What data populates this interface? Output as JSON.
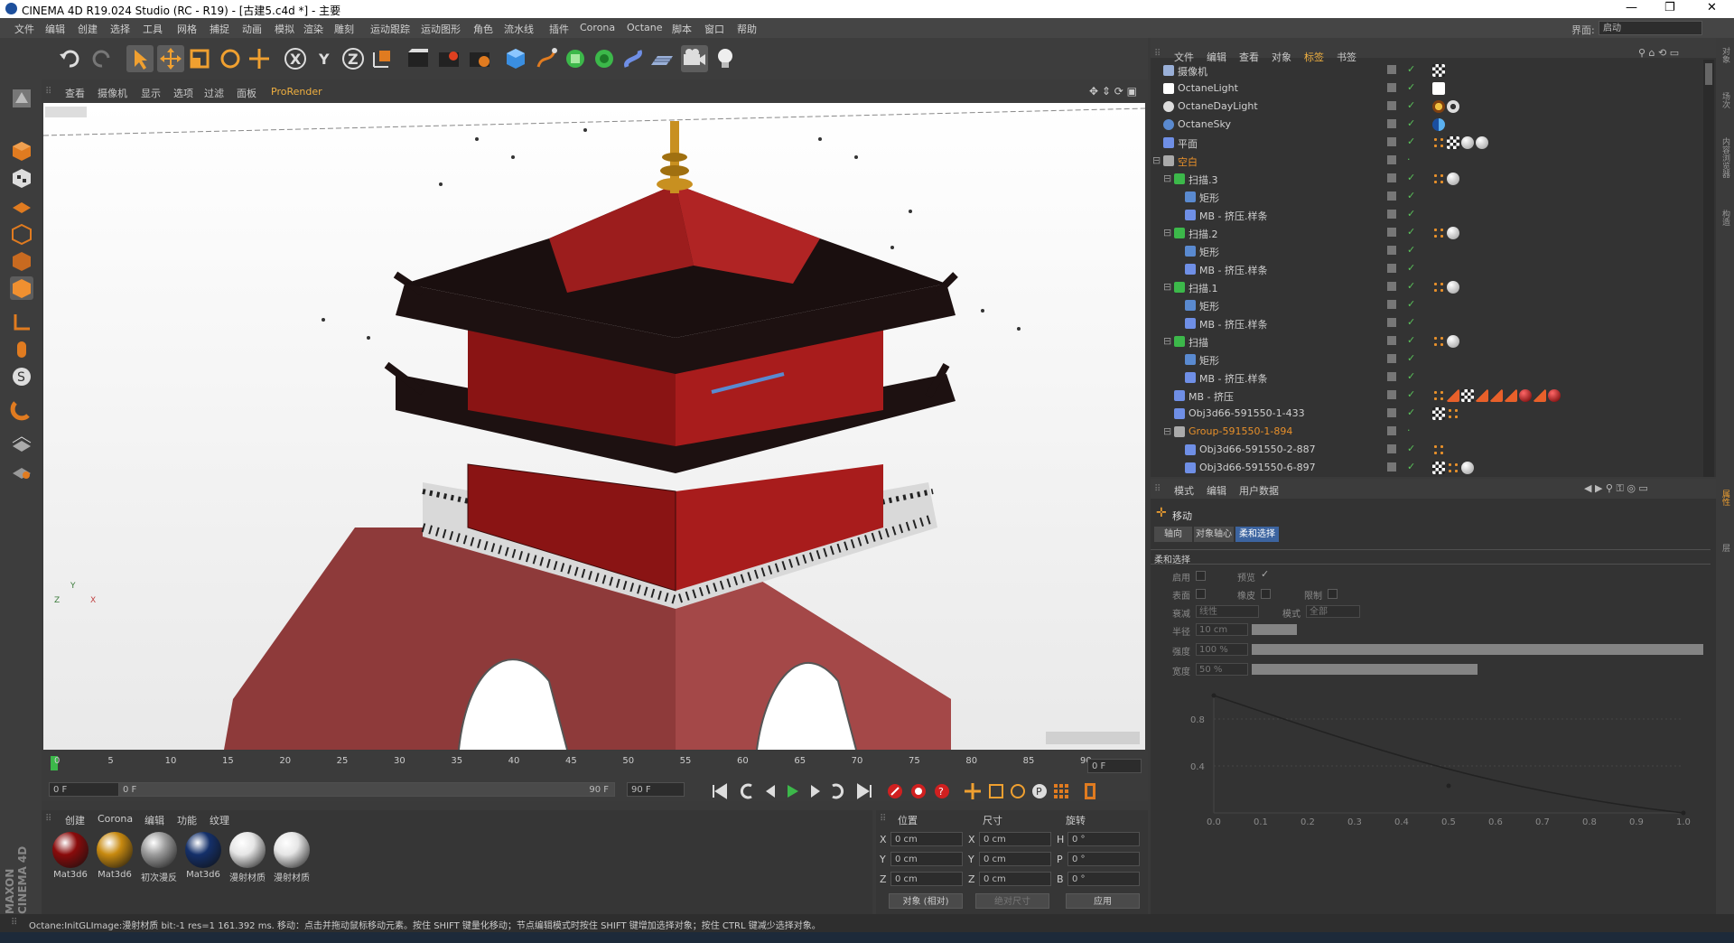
{
  "window": {
    "title": "CINEMA 4D R19.024 Studio (RC - R19) - [古建5.c4d *] - 主要",
    "controls": [
      "—",
      "❐",
      "✕"
    ]
  },
  "menubar": {
    "items": [
      "文件",
      "编辑",
      "创建",
      "选择",
      "工具",
      "网格",
      "捕捉",
      "动画",
      "模拟",
      "渲染",
      "雕刻",
      "运动跟踪",
      "运动图形",
      "角色",
      "流水线",
      "插件",
      "Corona",
      "Octane",
      "脚本",
      "窗口",
      "帮助"
    ],
    "layout_label": "界面:",
    "layout_value": "启动"
  },
  "viewport": {
    "menu": [
      "查看",
      "摄像机",
      "显示",
      "选项",
      "过滤",
      "面板",
      "ProRender"
    ],
    "axis_labels": {
      "y": "Y",
      "z": "Z",
      "x": "X"
    }
  },
  "timeline": {
    "ticks": [
      "0",
      "5",
      "10",
      "15",
      "20",
      "25",
      "30",
      "35",
      "40",
      "45",
      "50",
      "55",
      "60",
      "65",
      "70",
      "75",
      "80",
      "85",
      "90"
    ],
    "current_frame": "0 F",
    "start_frame": "0 F",
    "range_start": "0 F",
    "range_end": "90 F",
    "end_frame": "90 F",
    "playhead_fraction": 0
  },
  "material_manager": {
    "menu": [
      "创建",
      "Corona",
      "编辑",
      "功能",
      "纹理"
    ],
    "materials": [
      {
        "name": "Mat3d6",
        "color": "#8a0b0b"
      },
      {
        "name": "Mat3d6",
        "color": "#c88a10"
      },
      {
        "name": "初次漫反",
        "color": "#9c9c9c"
      },
      {
        "name": "Mat3d6",
        "color": "#14306a"
      },
      {
        "name": "漫射材质",
        "color": "#e6e6e6"
      },
      {
        "name": "漫射材质",
        "color": "#e6e6e6"
      }
    ]
  },
  "coordinates": {
    "headers": [
      "位置",
      "尺寸",
      "旋转"
    ],
    "rows": [
      {
        "axis": "X",
        "pos": "0 cm",
        "size_axis": "X",
        "size": "0 cm",
        "rot_axis": "H",
        "rot": "0 °"
      },
      {
        "axis": "Y",
        "pos": "0 cm",
        "size_axis": "Y",
        "size": "0 cm",
        "rot_axis": "P",
        "rot": "0 °"
      },
      {
        "axis": "Z",
        "pos": "0 cm",
        "size_axis": "Z",
        "size": "0 cm",
        "rot_axis": "B",
        "rot": "0 °"
      }
    ],
    "mode_select": "对象 (相对)",
    "size_select": "绝对尺寸",
    "apply_button": "应用"
  },
  "object_manager": {
    "menu": [
      "文件",
      "编辑",
      "查看",
      "对象",
      "标签",
      "书签"
    ],
    "active_menu": "标签",
    "objects": [
      {
        "name": "摄像机",
        "level": 0,
        "icon": "camera-icon",
        "orange": false,
        "tags": [
          "checker"
        ]
      },
      {
        "name": "OctaneLight",
        "level": 0,
        "icon": "light-icon",
        "orange": false,
        "tags": [
          "octane-light-tag"
        ]
      },
      {
        "name": "OctaneDayLight",
        "level": 0,
        "icon": "daylight-icon",
        "orange": false,
        "tags": [
          "sun",
          "gear"
        ]
      },
      {
        "name": "OctaneSky",
        "level": 0,
        "icon": "sky-icon",
        "orange": false,
        "tags": [
          "sky"
        ]
      },
      {
        "name": "平面",
        "level": 0,
        "icon": "plane-icon",
        "orange": false,
        "tags": [
          "dots",
          "checker",
          "ball",
          "ball"
        ]
      },
      {
        "name": "空白",
        "level": 0,
        "icon": "null-icon",
        "orange": true,
        "tags": []
      },
      {
        "name": "扫描.3",
        "level": 1,
        "icon": "sweep-icon",
        "orange": false,
        "tags": [
          "dots",
          "ball"
        ]
      },
      {
        "name": "矩形",
        "level": 2,
        "icon": "rect-icon",
        "orange": false,
        "tags": []
      },
      {
        "name": "MB - 挤压.样条",
        "level": 2,
        "icon": "spline-icon",
        "orange": false,
        "tags": []
      },
      {
        "name": "扫描.2",
        "level": 1,
        "icon": "sweep-icon",
        "orange": false,
        "tags": [
          "dots",
          "ball"
        ]
      },
      {
        "name": "矩形",
        "level": 2,
        "icon": "rect-icon",
        "orange": false,
        "tags": []
      },
      {
        "name": "MB - 挤压.样条",
        "level": 2,
        "icon": "spline-icon",
        "orange": false,
        "tags": []
      },
      {
        "name": "扫描.1",
        "level": 1,
        "icon": "sweep-icon",
        "orange": false,
        "tags": [
          "dots",
          "ball"
        ]
      },
      {
        "name": "矩形",
        "level": 2,
        "icon": "rect-icon",
        "orange": false,
        "tags": []
      },
      {
        "name": "MB - 挤压.样条",
        "level": 2,
        "icon": "spline-icon",
        "orange": false,
        "tags": []
      },
      {
        "name": "扫描",
        "level": 1,
        "icon": "sweep-icon",
        "orange": false,
        "tags": [
          "dots",
          "ball"
        ]
      },
      {
        "name": "矩形",
        "level": 2,
        "icon": "rect-icon",
        "orange": false,
        "tags": []
      },
      {
        "name": "MB - 挤压.样条",
        "level": 2,
        "icon": "spline-icon",
        "orange": false,
        "tags": []
      },
      {
        "name": "MB - 挤压",
        "level": 1,
        "icon": "polygon-icon",
        "orange": false,
        "tags": [
          "dots",
          "tri",
          "checker",
          "tri",
          "tri",
          "tri",
          "redball",
          "tri",
          "redball"
        ]
      },
      {
        "name": "Obj3d66-591550-1-433",
        "level": 1,
        "icon": "polygon-icon",
        "orange": false,
        "tags": [
          "checker",
          "dots"
        ]
      },
      {
        "name": "Group-591550-1-894",
        "level": 1,
        "icon": "null-icon",
        "orange": true,
        "tags": []
      },
      {
        "name": "Obj3d66-591550-2-887",
        "level": 2,
        "icon": "polygon-icon",
        "orange": false,
        "tags": [
          "dots"
        ]
      },
      {
        "name": "Obj3d66-591550-6-897",
        "level": 2,
        "icon": "polygon-icon",
        "orange": false,
        "tags": [
          "checker",
          "dots",
          "ball"
        ]
      }
    ]
  },
  "attribute_manager": {
    "menu": [
      "模式",
      "编辑",
      "用户数据"
    ],
    "tool_title": "移动",
    "tabs": [
      "轴向",
      "对象轴心",
      "柔和选择"
    ],
    "active_tab": "柔和选择",
    "section_title": "柔和选择",
    "labels": {
      "enable": "启用",
      "preview": "预览",
      "surface": "表面",
      "rubber": "橡皮",
      "restrict": "限制",
      "falloff": "衰减",
      "falloff_value": "线性",
      "mode": "模式",
      "mode_value": "全部",
      "radius": "半径",
      "radius_value": "10 cm",
      "strength": "强度",
      "strength_value": "100 %",
      "width": "宽度",
      "width_value": "50 %"
    },
    "levels": {
      "radius": 0.1,
      "strength": 1.0,
      "width": 0.5
    },
    "graph": {
      "y_ticks": [
        "0.8",
        "0.4"
      ],
      "x_ticks": [
        "0.0",
        "0.1",
        "0.2",
        "0.3",
        "0.4",
        "0.5",
        "0.6",
        "0.7",
        "0.8",
        "0.9",
        "1.0"
      ]
    }
  },
  "status_bar": {
    "text": "Octane:InitGLImage:漫射材质 bit:-1 res=1 161.392 ms.    移动：点击并拖动鼠标移动元素。按住 SHIFT 键量化移动；节点编辑模式时按住 SHIFT 键增加选择对象；按住 CTRL 键减少选择对象。"
  },
  "branding": "MAXON CINEMA 4D",
  "colors": {
    "accent": "#f0b040",
    "active_tab": "#3c64a0",
    "orange_object": "#e8902a",
    "check": "#5ac35a"
  }
}
